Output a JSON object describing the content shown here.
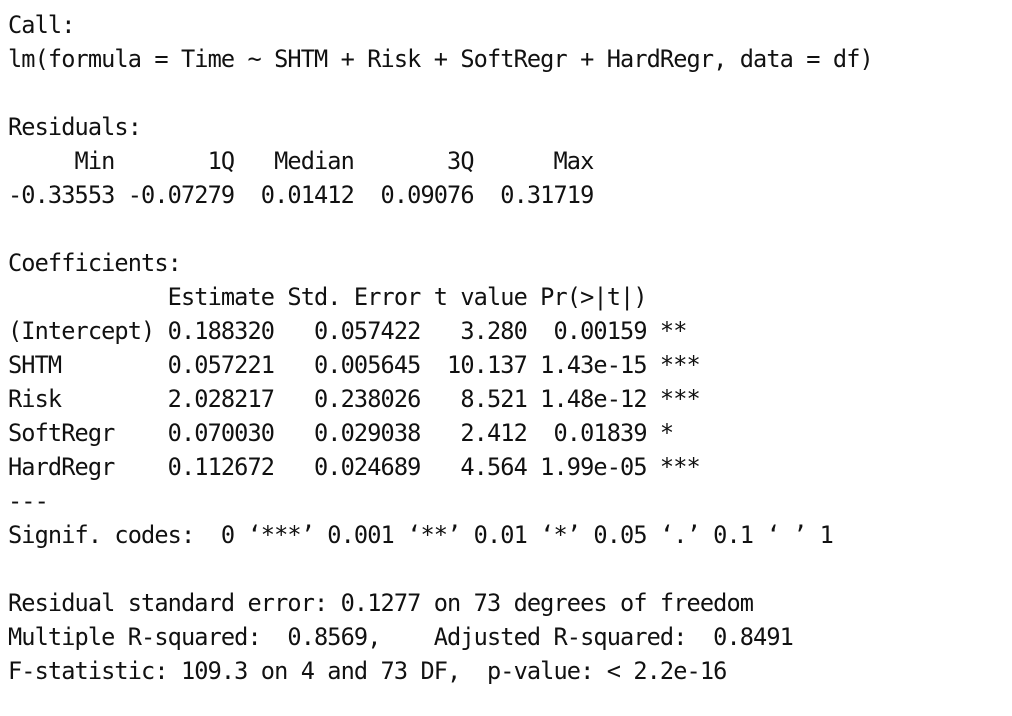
{
  "console": {
    "lines": [
      "Call:",
      "lm(formula = Time ~ SHTM + Risk + SoftRegr + HardRegr, data = df)",
      "",
      "Residuals:",
      "     Min       1Q   Median       3Q      Max ",
      "-0.33553 -0.07279  0.01412  0.09076  0.31719 ",
      "",
      "Coefficients:",
      "            Estimate Std. Error t value Pr(>|t|)    ",
      "(Intercept) 0.188320   0.057422   3.280  0.00159 ** ",
      "SHTM        0.057221   0.005645  10.137 1.43e-15 ***",
      "Risk        2.028217   0.238026   8.521 1.48e-12 ***",
      "SoftRegr    0.070030   0.029038   2.412  0.01839 *  ",
      "HardRegr    0.112672   0.024689   4.564 1.99e-05 ***",
      "---",
      "Signif. codes:  0 ‘***’ 0.001 ‘**’ 0.01 ‘*’ 0.05 ‘.’ 0.1 ‘ ’ 1",
      "",
      "Residual standard error: 0.1277 on 73 degrees of freedom",
      "Multiple R-squared:  0.8569,\tAdjusted R-squared:  0.8491 ",
      "F-statistic: 109.3 on 4 and 73 DF,  p-value: < 2.2e-16"
    ]
  }
}
